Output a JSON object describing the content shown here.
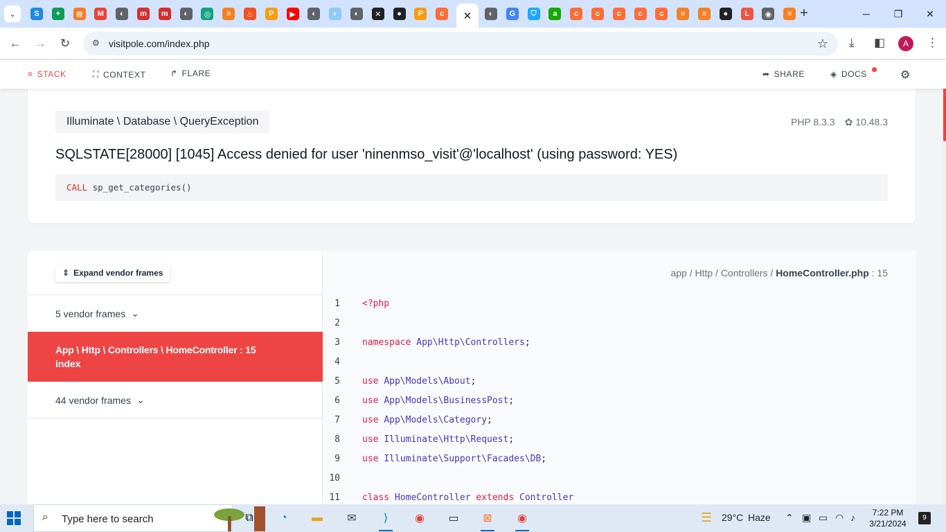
{
  "browser": {
    "tabs": [
      {
        "icon": "google-sheets-icon",
        "color": "#1e88e5",
        "glyph": "S"
      },
      {
        "icon": "sheets-icon",
        "color": "#0f9d58",
        "glyph": "+"
      },
      {
        "icon": "xampp-icon",
        "color": "#fb7a24",
        "glyph": "⊠"
      },
      {
        "icon": "gmail-icon",
        "color": "#ea4335",
        "glyph": "M"
      },
      {
        "icon": "globe-icon",
        "color": "#5f6368",
        "glyph": "◐"
      },
      {
        "icon": "makemytrip-icon",
        "color": "#d32f2f",
        "glyph": "m"
      },
      {
        "icon": "makemytrip-icon",
        "color": "#d32f2f",
        "glyph": "m"
      },
      {
        "icon": "globe-icon",
        "color": "#5f6368",
        "glyph": "◐"
      },
      {
        "icon": "chatgpt-icon",
        "color": "#10a37f",
        "glyph": "◎"
      },
      {
        "icon": "stackoverflow-icon",
        "color": "#f48024",
        "glyph": "≡"
      },
      {
        "icon": "fire-icon",
        "color": "#f4511e",
        "glyph": "♨"
      },
      {
        "icon": "phpmyadmin-icon",
        "color": "#f89c0e",
        "glyph": "P"
      },
      {
        "icon": "youtube-icon",
        "color": "#ff0000",
        "glyph": "▶"
      },
      {
        "icon": "globe-icon",
        "color": "#5f6368",
        "glyph": "◐"
      },
      {
        "icon": "globe-icon",
        "color": "#90caf9",
        "glyph": "◐"
      },
      {
        "icon": "globe-icon",
        "color": "#5f6368",
        "glyph": "◐"
      },
      {
        "icon": "x-icon",
        "color": "#202124",
        "glyph": "✕"
      },
      {
        "icon": "github-icon",
        "color": "#202124",
        "glyph": "●"
      },
      {
        "icon": "phpmyadmin-icon",
        "color": "#f89c0e",
        "glyph": "P"
      },
      {
        "icon": "postman-icon",
        "color": "#ff6c37",
        "glyph": "c"
      }
    ],
    "active_tab_close": "✕",
    "tabs_right": [
      {
        "icon": "globe-icon",
        "color": "#5f6368",
        "glyph": "◐"
      },
      {
        "icon": "google-icon",
        "color": "#4285f4",
        "glyph": "G"
      },
      {
        "icon": "shield-icon",
        "color": "#1ea7fd",
        "glyph": "⛉"
      },
      {
        "icon": "upwork-icon",
        "color": "#14a800",
        "glyph": "a"
      },
      {
        "icon": "postman-icon",
        "color": "#ff6c37",
        "glyph": "c"
      },
      {
        "icon": "postman-icon",
        "color": "#ff6c37",
        "glyph": "c"
      },
      {
        "icon": "postman-icon",
        "color": "#ff6c37",
        "glyph": "c"
      },
      {
        "icon": "postman-icon",
        "color": "#ff6c37",
        "glyph": "c"
      },
      {
        "icon": "postman-icon",
        "color": "#ff6c37",
        "glyph": "c"
      },
      {
        "icon": "stackoverflow-icon",
        "color": "#f48024",
        "glyph": "≡"
      },
      {
        "icon": "stackoverflow-icon",
        "color": "#f48024",
        "glyph": "≡"
      },
      {
        "icon": "github-icon",
        "color": "#202124",
        "glyph": "●"
      },
      {
        "icon": "laravel-icon",
        "color": "#f05340",
        "glyph": "L"
      },
      {
        "icon": "chrome-icon",
        "color": "#5f6368",
        "glyph": "◉"
      },
      {
        "icon": "stackoverflow-icon",
        "color": "#f48024",
        "glyph": "≡"
      }
    ],
    "new_tab": "+",
    "url": "visitpole.com/index.php",
    "avatar_letter": "A"
  },
  "ignition_nav": {
    "stack": "STACK",
    "context": "CONTEXT",
    "flare": "FLARE",
    "share": "SHARE",
    "docs": "DOCS"
  },
  "exception": {
    "class": "Illuminate \\ Database \\ QueryException",
    "php_version": "PHP 8.3.3",
    "laravel_version": "10.48.3",
    "message": "SQLSTATE[28000] [1045] Access denied for user 'ninenmso_visit'@'localhost' (using password: YES)",
    "sql_keyword": "CALL",
    "sql_rest": " sp_get_categories()"
  },
  "frames": {
    "expand_label": "Expand vendor frames",
    "vendor_top": "5 vendor frames",
    "active_path": "App \\ Http \\ Controllers \\ HomeController : 15",
    "active_method": "index",
    "vendor_bottom": "44 vendor frames"
  },
  "code": {
    "file_prefix": "app / Http / Controllers / ",
    "file_name": "HomeController.php",
    "file_line": " : 15",
    "lines": [
      {
        "n": "1",
        "parts": [
          [
            "k",
            "<?php"
          ]
        ]
      },
      {
        "n": "2",
        "parts": []
      },
      {
        "n": "3",
        "parts": [
          [
            "k",
            "namespace "
          ],
          [
            "ns",
            "App\\Http\\Controllers"
          ],
          [
            "p",
            ";"
          ]
        ]
      },
      {
        "n": "4",
        "parts": []
      },
      {
        "n": "5",
        "parts": [
          [
            "k",
            "use "
          ],
          [
            "ns",
            "App\\Models\\About"
          ],
          [
            "p",
            ";"
          ]
        ]
      },
      {
        "n": "6",
        "parts": [
          [
            "k",
            "use "
          ],
          [
            "ns",
            "App\\Models\\BusinessPost"
          ],
          [
            "p",
            ";"
          ]
        ]
      },
      {
        "n": "7",
        "parts": [
          [
            "k",
            "use "
          ],
          [
            "ns",
            "App\\Models\\Category"
          ],
          [
            "p",
            ";"
          ]
        ]
      },
      {
        "n": "8",
        "parts": [
          [
            "k",
            "use "
          ],
          [
            "ns",
            "Illuminate\\Http\\Request"
          ],
          [
            "p",
            ";"
          ]
        ]
      },
      {
        "n": "9",
        "parts": [
          [
            "k",
            "use "
          ],
          [
            "ns",
            "Illuminate\\Support\\Facades\\DB"
          ],
          [
            "p",
            ";"
          ]
        ]
      },
      {
        "n": "10",
        "parts": []
      },
      {
        "n": "11",
        "parts": [
          [
            "k",
            "class "
          ],
          [
            "ns",
            "HomeController "
          ],
          [
            "k",
            "extends "
          ],
          [
            "ns",
            "Controller"
          ]
        ]
      }
    ]
  },
  "taskbar": {
    "search_placeholder": "Type here to search",
    "weather_temp": "29°C",
    "weather_text": "Haze",
    "time": "7:22 PM",
    "date": "3/21/2024",
    "notification_count": "9"
  },
  "colors": {
    "accent": "#ef4444",
    "tabstrip": "#d3e3fd"
  }
}
